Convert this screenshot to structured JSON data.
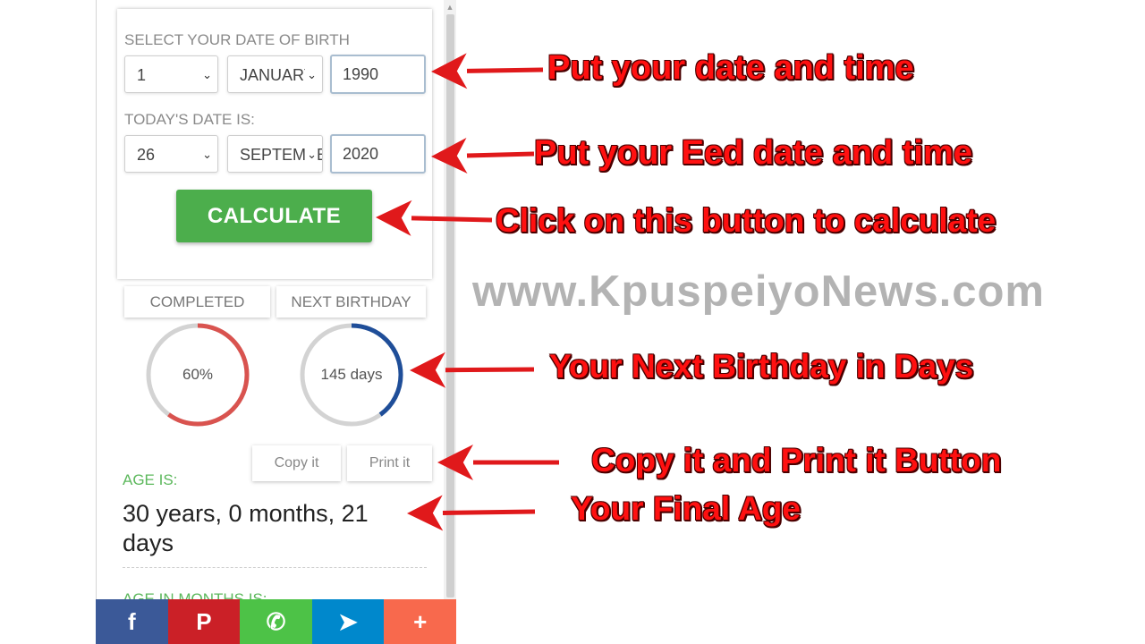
{
  "form": {
    "dob_label": "SELECT YOUR DATE OF BIRTH",
    "dob_day": "1",
    "dob_month": "JANUARY",
    "dob_year": "1990",
    "today_label": "TODAY'S DATE IS:",
    "today_day": "26",
    "today_month": "SEPTEMBER",
    "today_year": "2020",
    "calculate_label": "CALCULATE"
  },
  "results": {
    "tabs": [
      "COMPLETED",
      "NEXT BIRTHDAY"
    ],
    "completed_text": "60%",
    "completed_fraction": 0.6,
    "next_birthday_text": "145 days",
    "next_birthday_fraction": 0.4,
    "completed_color": "#d9534f",
    "next_birthday_color": "#1f4e99",
    "copy_label": "Copy it",
    "print_label": "Print it",
    "age_label": "AGE IS:",
    "age_value": "30 years, 0 months, 21 days",
    "next_section_label": "AGE IN MONTHS IS:"
  },
  "share_bar": [
    {
      "icon": "facebook-icon",
      "glyph": "f",
      "color": "#3b5998"
    },
    {
      "icon": "pinterest-icon",
      "glyph": "P",
      "color": "#cb2027"
    },
    {
      "icon": "whatsapp-icon",
      "glyph": "✆",
      "color": "#4dc247"
    },
    {
      "icon": "telegram-icon",
      "glyph": "➤",
      "color": "#0088cc"
    },
    {
      "icon": "plus-icon",
      "glyph": "+",
      "color": "#f8694d"
    }
  ],
  "annotations": {
    "date_note": "Put your date and time",
    "end_date_note": "Put your Eed date and time",
    "calculate_note": "Click on this button to calculate",
    "birthday_note": "Your Next Birthday in Days",
    "copy_print_note": "Copy it and Print it Button",
    "final_age_note": "Your Final Age",
    "watermark": "www.KpuspeiyoNews.com",
    "arrow_color": "#e0191b"
  }
}
